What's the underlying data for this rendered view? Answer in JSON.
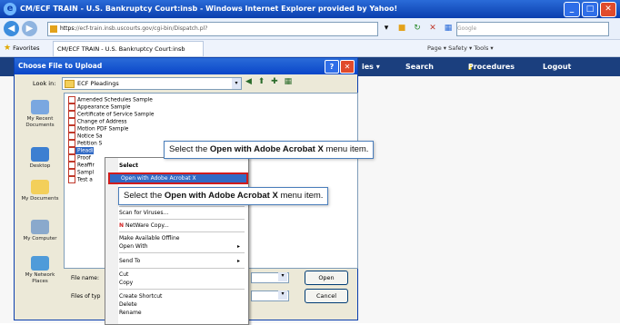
{
  "window": {
    "title": "CM/ECF TRAIN - U.S. Bankruptcy Court:insb - Windows Internet Explorer provided by Yahoo!",
    "controls": [
      "_",
      "□",
      "✕"
    ]
  },
  "address_bar": {
    "url_bold": "https:",
    "url_rest": "//ecf-train.insb.uscourts.gov/cgi-bin/Dispatch.pl?",
    "search_placeholder": "Google"
  },
  "favorites_bar": {
    "favorites_label": "Favorites",
    "tab_label": "CM/ECF TRAIN - U.S. Bankruptcy Court:insb",
    "commands": "Page ▾  Safety ▾  Tools ▾"
  },
  "app_nav": {
    "items": [
      "ies ▾",
      "Search",
      "Procedures",
      "Logout"
    ]
  },
  "dialog": {
    "title": "Choose File to Upload",
    "look_in_label": "Look in:",
    "look_in_value": "ECF Pleadings",
    "places": [
      "My Recent Documents",
      "Desktop",
      "My Documents",
      "My Computer",
      "My Network Places"
    ],
    "files": [
      "Amended Schedules Sample",
      "Appearance Sample",
      "Certificate of Service Sample",
      "Change of Address",
      "Motion PDF Sample",
      "Notice Sa",
      "Petition S",
      "Pleadi",
      "Proof",
      "Reaffir",
      "Sampl",
      "Test a"
    ],
    "selected_file_index": 7,
    "file_name_label": "File name:",
    "files_of_type_label": "Files of typ",
    "open_button": "Open",
    "cancel_button": "Cancel"
  },
  "context_menu": {
    "items": [
      {
        "label": "Select",
        "bold": true
      },
      {
        "label": "Open with Adobe Acrobat X",
        "highlighted": true
      },
      {
        "label": "Scan for Viruses..."
      },
      {
        "label": "NetWare Copy..."
      },
      {
        "label": "Make Available Offline"
      },
      {
        "label": "Open With"
      },
      {
        "label": "Send To"
      },
      {
        "label": "Cut"
      },
      {
        "label": "Copy"
      },
      {
        "label": "Create Shortcut"
      },
      {
        "label": "Delete"
      },
      {
        "label": "Rename"
      }
    ]
  },
  "callouts": {
    "first": {
      "pre": "Select the ",
      "bold": "Open with Adobe Acrobat X",
      "post": " menu item."
    },
    "second": {
      "pre": "Select the ",
      "bold": "Open with Adobe Acrobat X",
      "post": " menu item."
    }
  }
}
